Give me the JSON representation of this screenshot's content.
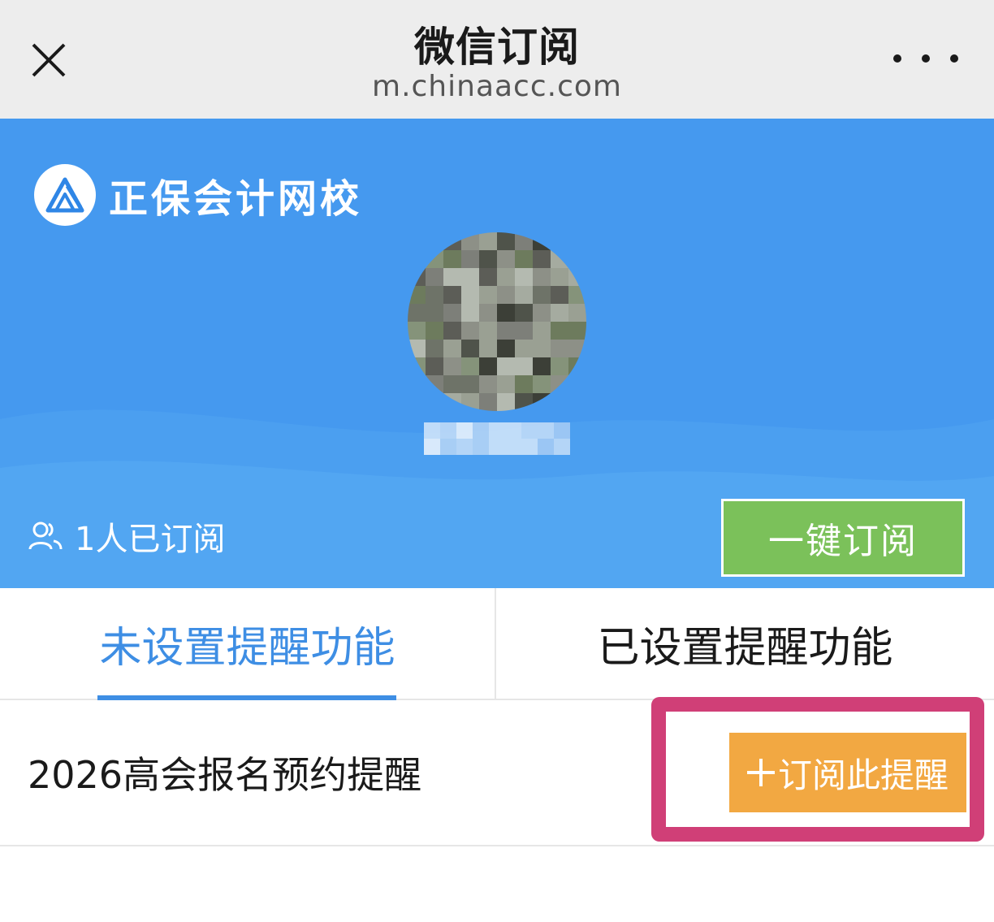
{
  "navbar": {
    "title": "微信订阅",
    "subtitle": "m.chinaacc.com",
    "close_icon": "close-icon",
    "more_icon": "more-dots-icon"
  },
  "banner": {
    "brand_name": "正保会计网校",
    "brand_logo_icon": "chinaacc-logo-icon",
    "subscriber_text": "1人已订阅",
    "subscriber_icon": "users-icon",
    "subscribe_all_label": "一键订阅",
    "background_color": "#4599ef",
    "button_color": "#7bc15a"
  },
  "tabs": [
    {
      "label": "未设置提醒功能",
      "active": true
    },
    {
      "label": "已设置提醒功能",
      "active": false
    }
  ],
  "reminders": [
    {
      "title": "2026高会报名预约提醒",
      "action_label": "订阅此提醒",
      "action_icon": "plus-icon"
    }
  ],
  "colors": {
    "accent_blue": "#3e8ee4",
    "action_orange": "#f2a842",
    "highlight_pink": "#d03f77"
  }
}
